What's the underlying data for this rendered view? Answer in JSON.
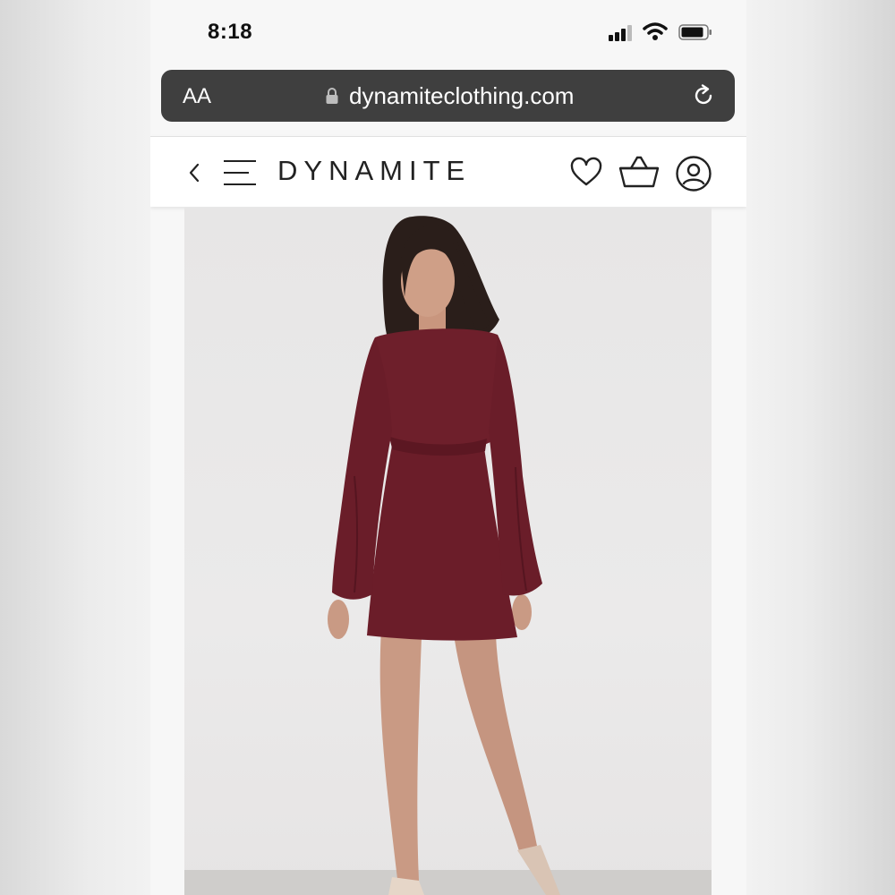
{
  "status_bar": {
    "time": "8:18"
  },
  "browser": {
    "text_size_label": "AA",
    "url": "dynamiteclothing.com"
  },
  "site": {
    "logo_text": "DYNAMITE"
  },
  "icons": {
    "back": "chevron-left-icon",
    "menu": "hamburger-menu-icon",
    "wishlist": "heart-icon",
    "bag": "shopping-bag-icon",
    "account": "user-icon",
    "lock": "lock-icon",
    "reload": "reload-icon"
  },
  "colors": {
    "dress": "#6e1f2b",
    "url_bar": "#3f3f3f"
  }
}
